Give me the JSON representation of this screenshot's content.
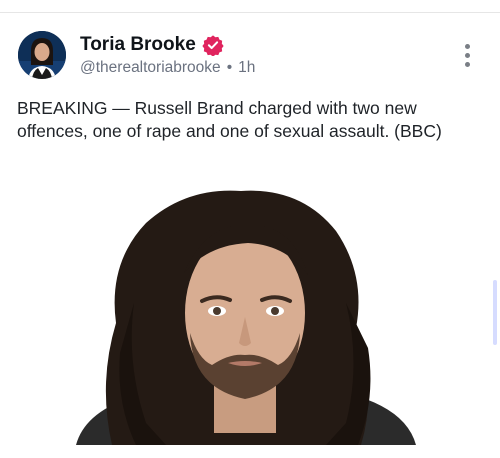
{
  "post": {
    "author_name": "Toria Brooke",
    "handle": "@therealtoriabrooke",
    "separator": "•",
    "time": "1h",
    "text": "BREAKING — Russell Brand charged with two new offences, one of rape and one of sexual assault. (BBC)"
  },
  "icons": {
    "verified": "verified-badge-icon",
    "more": "more-options-icon"
  },
  "colors": {
    "verified_badge": "#e0245e",
    "handle_text": "#6b7280",
    "scrollbar": "#d6dcff"
  }
}
